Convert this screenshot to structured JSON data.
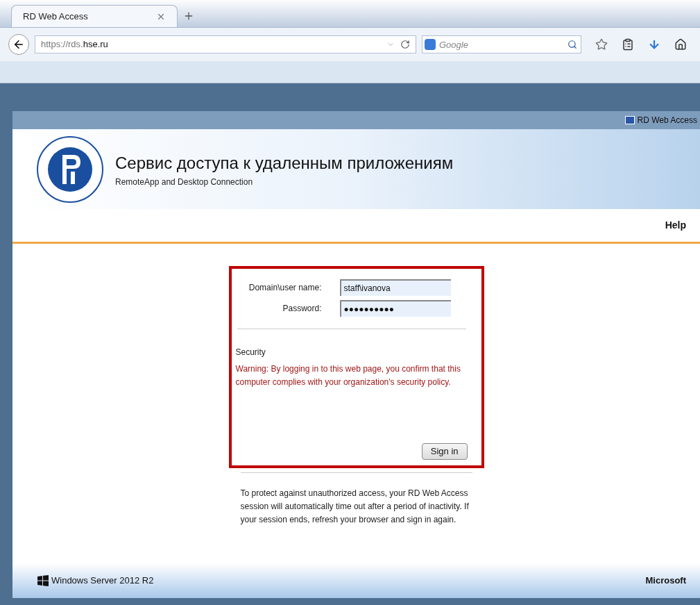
{
  "browser": {
    "tabs": [
      {
        "label": "RD Web Access",
        "selected": true
      }
    ],
    "url_prefix": "https://rds.",
    "url_domain": "hse.ru",
    "search_placeholder": "Google"
  },
  "page": {
    "top_strip_label": "RD Web Access",
    "title": "Сервис доступа к удаленным приложениям",
    "subtitle": "RemoteApp and Desktop Connection",
    "help": "Help",
    "form": {
      "fields": [
        {
          "label": "Domain\\user name:",
          "value": "staff\\ivanova"
        },
        {
          "label": "Password:",
          "value": "●●●●●●●●●●"
        }
      ],
      "security_heading": "Security",
      "warning": "Warning: By logging in to this web page, you confirm that this computer complies with your organization's security policy.",
      "sign_in": "Sign in",
      "highlighted": true
    },
    "note": "To protect against unauthorized access, your RD Web Access session will automatically time out after a period of inactivity. If your session ends, refresh your browser and sign in again.",
    "footer_product": "Windows Server 2012 R2",
    "footer_brand": "Microsoft"
  }
}
